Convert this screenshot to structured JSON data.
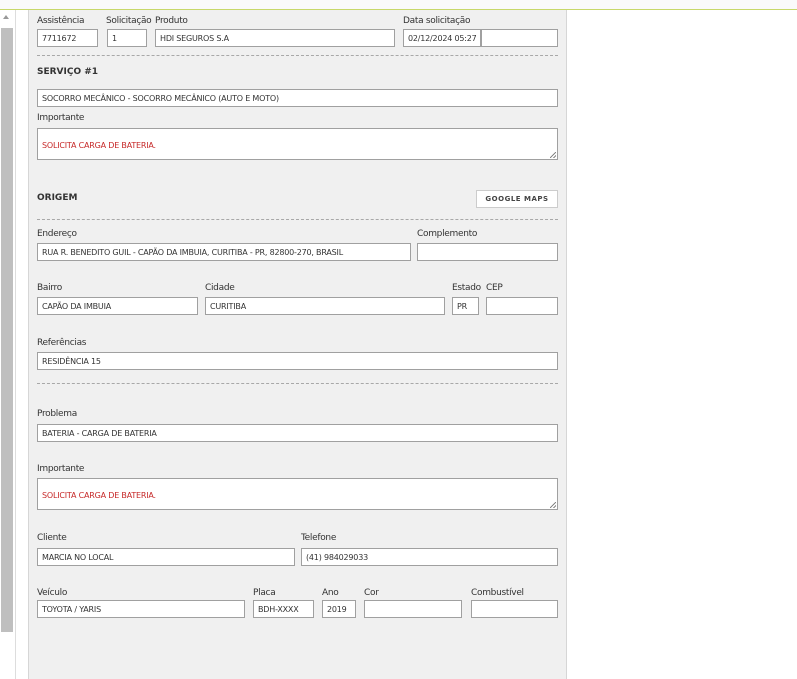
{
  "header": {
    "assistencia_label": "Assistência",
    "assistencia": "7711672",
    "solicitacao_label": "Solicitação",
    "solicitacao": "1",
    "produto_label": "Produto",
    "produto": "HDI SEGUROS S.A",
    "data_label": "Data solicitação",
    "data": "02/12/2024 05:27",
    "data_extra": ""
  },
  "servico": {
    "title": "SERVIÇO #1",
    "nome": "SOCORRO MECÂNICO - SOCORRO MECÂNICO (AUTO E MOTO)",
    "importante_label": "Importante",
    "importante": "SOLICITA CARGA DE BATERIA."
  },
  "origem": {
    "title": "ORIGEM",
    "maps_button": "GOOGLE MAPS",
    "endereco_label": "Endereço",
    "endereco": "RUA R. BENEDITO GUIL - CAPÃO DA IMBUIA, CURITIBA - PR, 82800-270, BRASIL",
    "complemento_label": "Complemento",
    "complemento": "",
    "bairro_label": "Bairro",
    "bairro": "CAPÃO DA IMBUIA",
    "cidade_label": "Cidade",
    "cidade": "CURITIBA",
    "estado_label": "Estado",
    "estado": "PR",
    "cep_label": "CEP",
    "cep": "",
    "referencias_label": "Referências",
    "referencias": "RESIDÊNCIA 15"
  },
  "problema": {
    "label": "Problema",
    "value": "BATERIA - CARGA DE BATERIA",
    "importante_label": "Importante",
    "importante": "SOLICITA CARGA DE BATERIA."
  },
  "cliente": {
    "label": "Cliente",
    "value": "MARCIA NO LOCAL",
    "telefone_label": "Telefone",
    "telefone": "(41) 984029033"
  },
  "veiculo": {
    "label": "Veículo",
    "value": "TOYOTA / YARIS",
    "placa_label": "Placa",
    "placa": "BDH-XXXX",
    "ano_label": "Ano",
    "ano": "2019",
    "cor_label": "Cor",
    "cor": "",
    "combustivel_label": "Combustível",
    "combustivel": ""
  }
}
